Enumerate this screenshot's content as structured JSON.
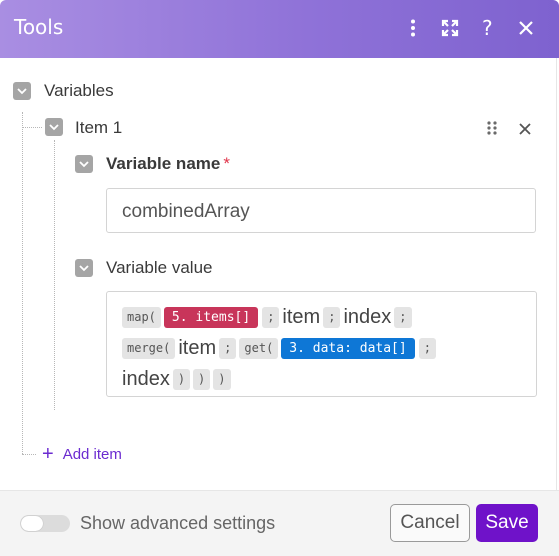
{
  "header": {
    "title": "Tools"
  },
  "section": {
    "label": "Variables"
  },
  "item": {
    "label": "Item 1"
  },
  "variable_name": {
    "label": "Variable name",
    "required_mark": "*",
    "value": "combinedArray"
  },
  "variable_value": {
    "label": "Variable value",
    "line1": {
      "map": "map(",
      "pill": "5. items[]",
      "sep1": ";",
      "item": "item",
      "sep2": ";",
      "index": "index",
      "sep3": ";"
    },
    "line2": {
      "merge": "merge(",
      "item": "item",
      "sep1": ";",
      "get": "get(",
      "pill": "3. data: data[]",
      "sep2": ";"
    },
    "line3": {
      "index": "index",
      "close1": ")",
      "close2": ")",
      "close3": ")"
    }
  },
  "add_item": {
    "label": "Add item"
  },
  "footer": {
    "advanced_label": "Show advanced settings",
    "advanced_on": false,
    "cancel_label": "Cancel",
    "save_label": "Save"
  },
  "colors": {
    "accent": "#6f12c9",
    "header": "#8f72d8",
    "pill_red": "#c8355a",
    "pill_blue": "#0e77d6"
  },
  "icons": [
    "more-vertical-icon",
    "expand-icon",
    "help-icon",
    "close-icon",
    "drag-handle-icon",
    "remove-item-icon",
    "plus-icon",
    "chevron-down-icon"
  ]
}
